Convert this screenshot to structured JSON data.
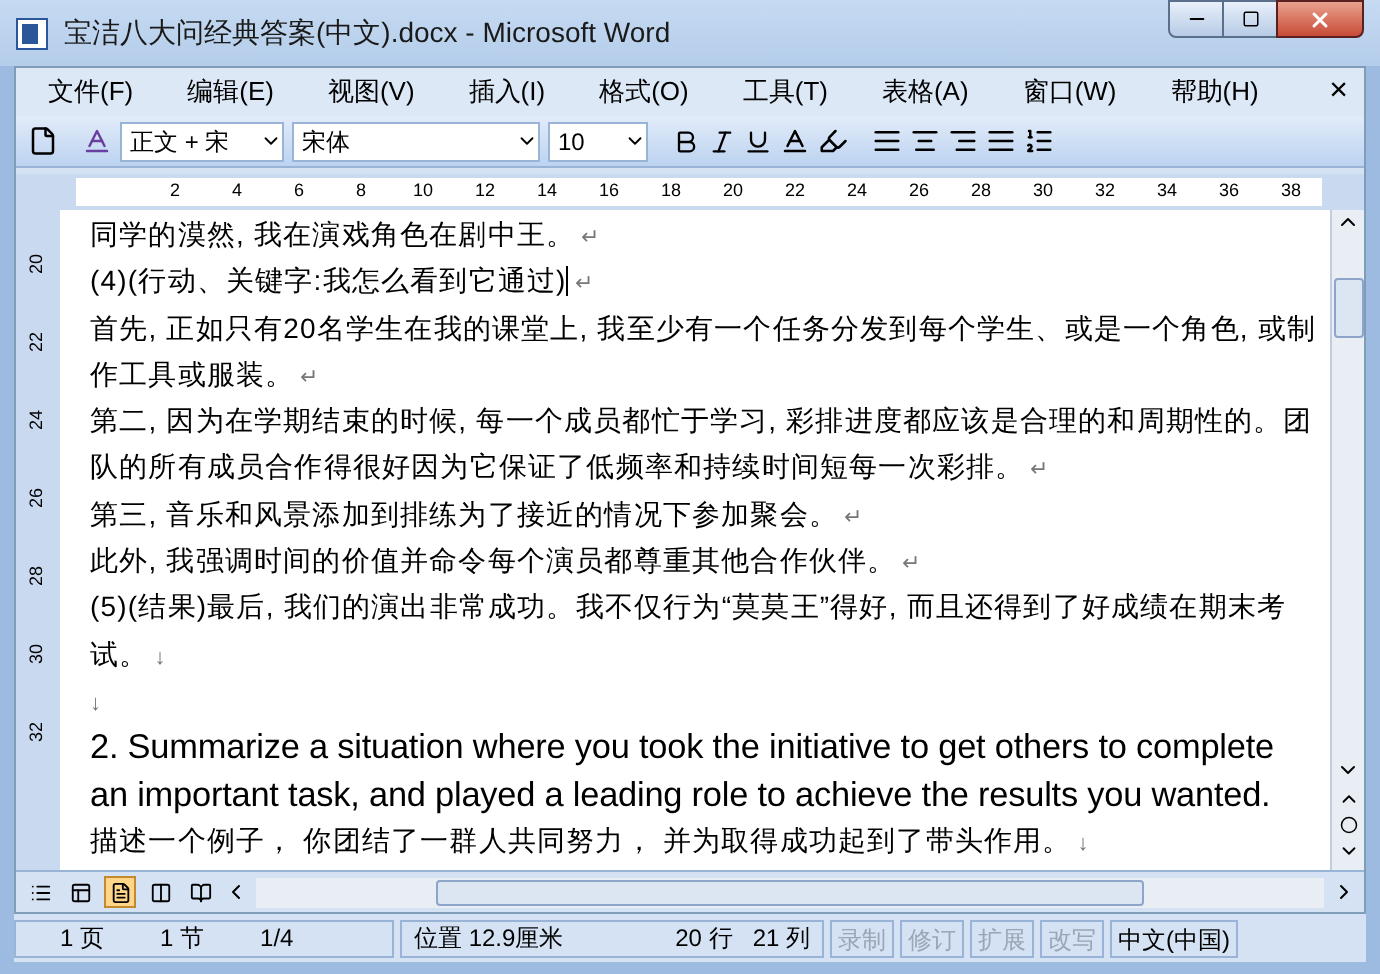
{
  "window": {
    "title": "宝洁八大问经典答案(中文).docx - Microsoft Word"
  },
  "menu": {
    "items": [
      {
        "label": "文件(F)"
      },
      {
        "label": "编辑(E)"
      },
      {
        "label": "视图(V)"
      },
      {
        "label": "插入(I)"
      },
      {
        "label": "格式(O)"
      },
      {
        "label": "工具(T)"
      },
      {
        "label": "表格(A)"
      },
      {
        "label": "窗口(W)"
      },
      {
        "label": "帮助(H)"
      }
    ],
    "close": "×"
  },
  "toolbar": {
    "style": "正文 + 宋",
    "font": "宋体",
    "size": "10"
  },
  "ruler": {
    "marks": [
      "2",
      "4",
      "6",
      "8",
      "10",
      "12",
      "14",
      "16",
      "18",
      "20",
      "22",
      "24",
      "26",
      "28",
      "30",
      "32",
      "34",
      "36",
      "38"
    ]
  },
  "vertical_ruler": {
    "marks": [
      "20",
      "22",
      "24",
      "26",
      "28",
      "30",
      "32"
    ]
  },
  "document": {
    "paragraphs": [
      {
        "kind": "zh",
        "text": "同学的漠然, 我在演戏角色在剧中王。",
        "mark": "↵"
      },
      {
        "kind": "zh",
        "text": "(4)(行动、关键字:我怎么看到它通过)",
        "mark": "↵",
        "cursor": true
      },
      {
        "kind": "zh",
        "text": "首先, 正如只有20名学生在我的课堂上, 我至少有一个任务分发到每个学生、或是一个角色, 或制作工具或服装。",
        "mark": "↵"
      },
      {
        "kind": "zh",
        "text": "第二, 因为在学期结束的时候, 每一个成员都忙于学习, 彩排进度都应该是合理的和周期性的。团队的所有成员合作得很好因为它保证了低频率和持续时间短每一次彩排。",
        "mark": "↵"
      },
      {
        "kind": "zh",
        "text": "第三, 音乐和风景添加到排练为了接近的情况下参加聚会。",
        "mark": "↵"
      },
      {
        "kind": "zh",
        "text": "此外, 我强调时间的价值并命令每个演员都尊重其他合作伙伴。",
        "mark": "↵"
      },
      {
        "kind": "zh",
        "text": "(5)(结果)最后, 我们的演出非常成功。我不仅行为“莫莫王”得好, 而且还得到了好成绩在期末考试。",
        "mark": "↓"
      },
      {
        "kind": "empty",
        "mark": "↓"
      },
      {
        "kind": "en",
        "text": "2. Summarize a situation where you took the initiative to get others to complete an important task, and played a leading role to achieve the results you wanted."
      },
      {
        "kind": "zh",
        "text": "描述一个例子，  你团结了一群人共同努力，  并为取得成功起到了带头作用。",
        "mark": "↓"
      }
    ]
  },
  "view_buttons": [
    {
      "selected": false
    },
    {
      "selected": false
    },
    {
      "selected": true
    },
    {
      "selected": false
    },
    {
      "selected": false
    }
  ],
  "status_bar": {
    "page": "1 页",
    "section": "1 节",
    "pages": "1/4",
    "position": "位置 12.9厘米",
    "line": "20 行",
    "column": "21 列",
    "modes": [
      {
        "label": "录制",
        "disabled": true
      },
      {
        "label": "修订",
        "disabled": true
      },
      {
        "label": "扩展",
        "disabled": true
      },
      {
        "label": "改写",
        "disabled": true
      }
    ],
    "language": "中文(中国)"
  }
}
